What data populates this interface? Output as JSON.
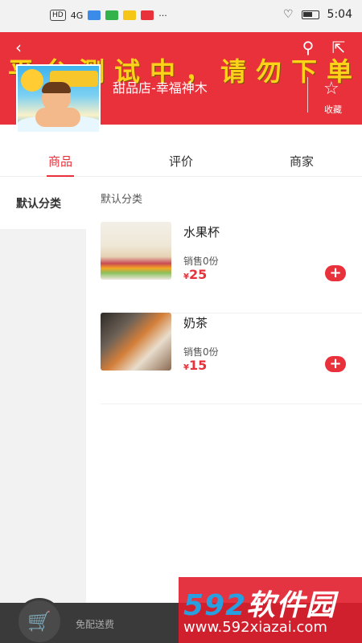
{
  "status_bar": {
    "network_badge": "HD",
    "network_type": "4G",
    "time": "5:04"
  },
  "header": {
    "marquee_text": "平台测试中，请勿下单",
    "shop_name": "甜品店-幸福神木",
    "favorite_label": "收藏",
    "icons": [
      "back-icon",
      "search-icon",
      "share-icon",
      "star-icon"
    ],
    "background_color": "#e8313a"
  },
  "tabs": [
    {
      "label": "商品",
      "active": true
    },
    {
      "label": "评价",
      "active": false
    },
    {
      "label": "商家",
      "active": false
    }
  ],
  "sidebar": {
    "items": [
      {
        "label": "默认分类",
        "active": true
      }
    ]
  },
  "main": {
    "category_title": "默认分类",
    "products": [
      {
        "name": "水果杯",
        "sales": "销售0份",
        "currency": "¥",
        "price": "25"
      },
      {
        "name": "奶茶",
        "sales": "销售0份",
        "currency": "¥",
        "price": "15"
      }
    ]
  },
  "cart_bar": {
    "delivery_text": "免配送费"
  },
  "watermark": {
    "brand_number": "592",
    "brand_text": "软件园",
    "url": "www.592xiazai.com"
  },
  "colors": {
    "accent": "#e8313a",
    "marquee": "#ffd21a",
    "cart_bar": "#3a3a3a"
  }
}
